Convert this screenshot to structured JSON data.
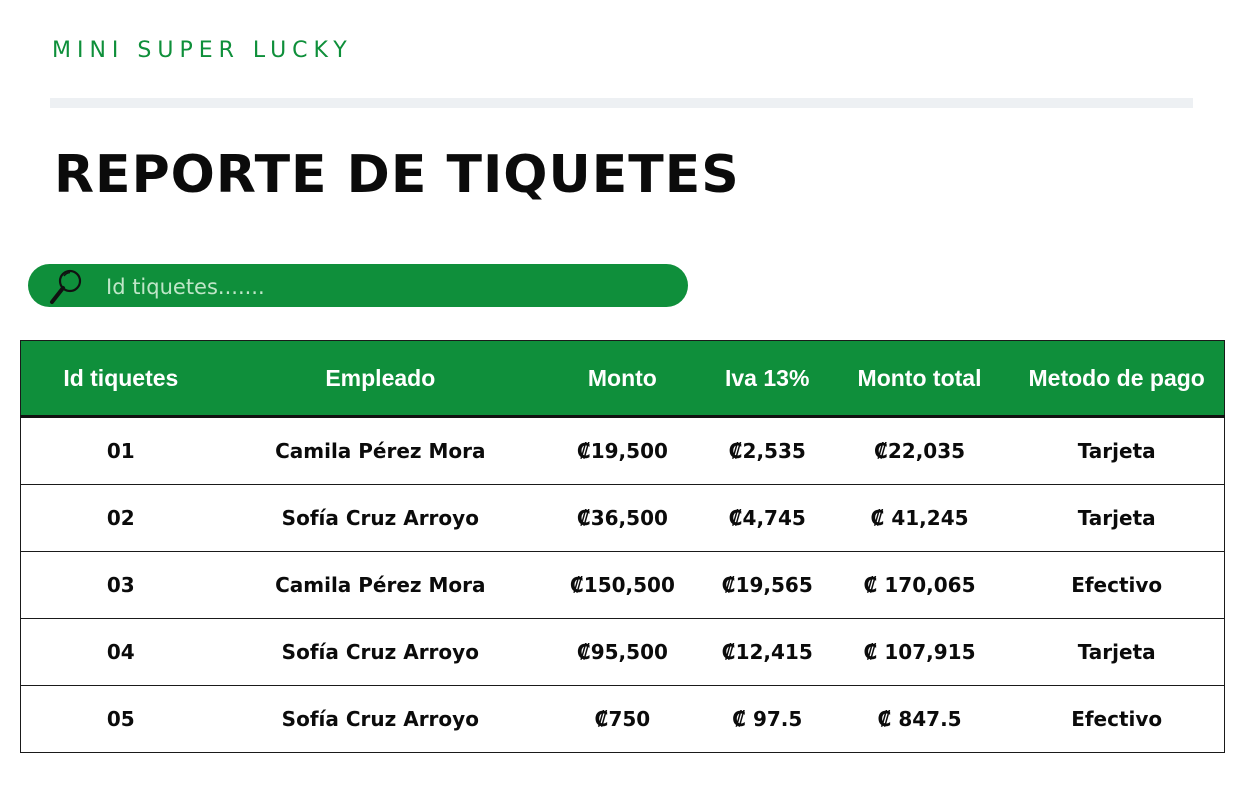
{
  "brand": "MINI SUPER LUCKY",
  "page_title": "REPORTE DE TIQUETES",
  "search": {
    "placeholder": "Id tiquetes.......",
    "value": ""
  },
  "colors": {
    "accent": "#0f8f3b",
    "brand_text": "#0e8f3a",
    "divider": "#edf0f3"
  },
  "icons": {
    "search": "magnifier-icon"
  },
  "table": {
    "headers": [
      "Id tiquetes",
      "Empleado",
      "Monto",
      "Iva 13%",
      "Monto total",
      "Metodo de pago"
    ],
    "rows": [
      [
        "01",
        "Camila Pérez Mora",
        "₡19,500",
        "₡2,535",
        "₡22,035",
        "Tarjeta"
      ],
      [
        "02",
        "Sofía Cruz Arroyo",
        "₡36,500",
        "₡4,745",
        "₡ 41,245",
        "Tarjeta"
      ],
      [
        "03",
        "Camila Pérez Mora",
        "₡150,500",
        "₡19,565",
        "₡ 170,065",
        "Efectivo"
      ],
      [
        "04",
        "Sofía Cruz Arroyo",
        "₡95,500",
        "₡12,415",
        "₡ 107,915",
        "Tarjeta"
      ],
      [
        "05",
        "Sofía Cruz Arroyo",
        "₡750",
        "₡ 97.5",
        "₡ 847.5",
        "Efectivo"
      ]
    ]
  }
}
